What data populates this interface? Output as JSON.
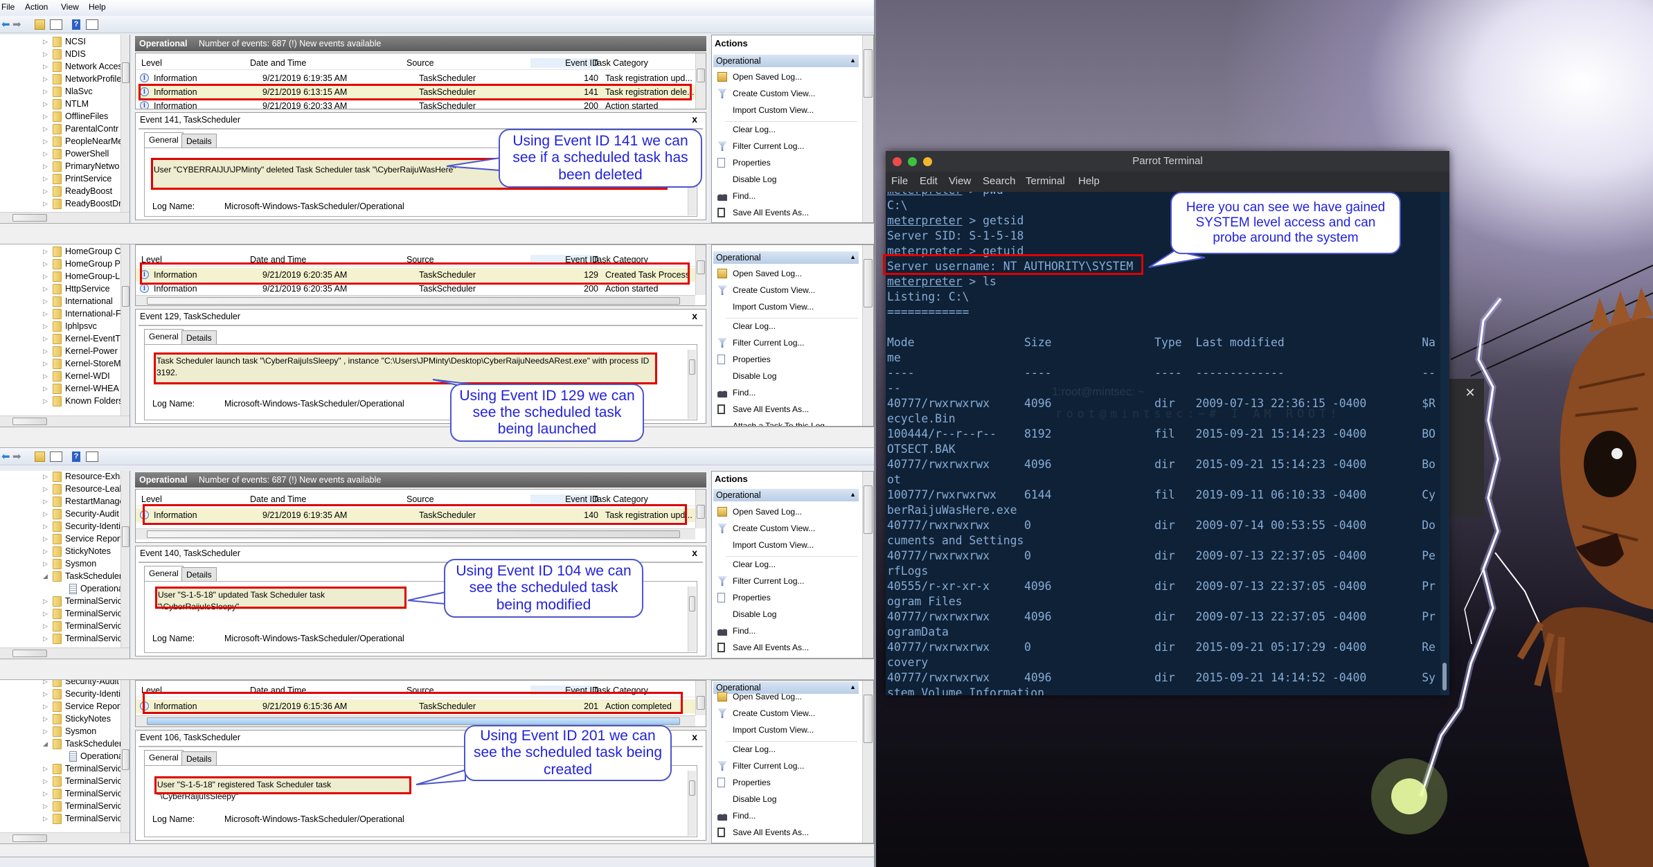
{
  "event_viewer": {
    "menu": [
      "File",
      "Action",
      "View",
      "Help"
    ],
    "columns": [
      "Level",
      "Date and Time",
      "Source",
      "Event ID",
      "Task Category"
    ],
    "tabs": [
      "General",
      "Details"
    ],
    "log_name_label": "Log Name:",
    "log_name": "Microsoft-Windows-TaskScheduler/Operational",
    "actions_header": "Actions",
    "actions_section": "Operational",
    "actions": [
      {
        "label": "Open Saved Log...",
        "icon": "open-folder-icon"
      },
      {
        "label": "Create Custom View...",
        "icon": "filter-icon"
      },
      {
        "label": "Import Custom View...",
        "icon": ""
      },
      {
        "label": "Clear Log...",
        "icon": ""
      },
      {
        "label": "Filter Current Log...",
        "icon": "filter-icon"
      },
      {
        "label": "Properties",
        "icon": "properties-icon"
      },
      {
        "label": "Disable Log",
        "icon": ""
      },
      {
        "label": "Find...",
        "icon": "binoculars-icon"
      },
      {
        "label": "Save All Events As...",
        "icon": "save-icon"
      },
      {
        "label": "Attach a Task To this Log...",
        "icon": ""
      }
    ],
    "panels": [
      {
        "header": {
          "title": "Operational",
          "info": "Number of events: 687 (!) New events available"
        },
        "tree": [
          {
            "label": "NCSI"
          },
          {
            "label": "NDIS"
          },
          {
            "label": "Network Acces"
          },
          {
            "label": "NetworkProfile"
          },
          {
            "label": "NlaSvc"
          },
          {
            "label": "NTLM"
          },
          {
            "label": "OfflineFiles"
          },
          {
            "label": "ParentalContr"
          },
          {
            "label": "PeopleNearMe"
          },
          {
            "label": "PowerShell"
          },
          {
            "label": "PrimaryNetwo"
          },
          {
            "label": "PrintService"
          },
          {
            "label": "ReadyBoost"
          },
          {
            "label": "ReadyBoostDri"
          }
        ],
        "rows": [
          {
            "level": "Information",
            "date": "9/21/2019 6:19:35 AM",
            "source": "TaskScheduler",
            "id": "140",
            "category": "Task registration upd...",
            "highlight": false
          },
          {
            "level": "Information",
            "date": "9/21/2019 6:13:15 AM",
            "source": "TaskScheduler",
            "id": "141",
            "category": "Task registration dele...",
            "highlight": true
          },
          {
            "level": "Information",
            "date": "9/21/2019 6:20:33 AM",
            "source": "TaskScheduler",
            "id": "200",
            "category": "Action started",
            "highlight": false
          }
        ],
        "detail_title": "Event 141, TaskScheduler",
        "message": "User \"CYBERRAIJU\\JPMinty\"  deleted Task Scheduler task \"\\CyberRaijuWasHere\""
      },
      {
        "header": null,
        "tree": [
          {
            "label": "HomeGroup C"
          },
          {
            "label": "HomeGroup P"
          },
          {
            "label": "HomeGroup-L"
          },
          {
            "label": "HttpService"
          },
          {
            "label": "International"
          },
          {
            "label": "International-F"
          },
          {
            "label": "Iphlpsvc"
          },
          {
            "label": "Kernel-EventTr"
          },
          {
            "label": "Kernel-Power"
          },
          {
            "label": "Kernel-StoreM"
          },
          {
            "label": "Kernel-WDI"
          },
          {
            "label": "Kernel-WHEA"
          },
          {
            "label": "Known Folders"
          }
        ],
        "rows": [
          {
            "level": "Information",
            "date": "9/21/2019 6:20:35 AM",
            "source": "TaskScheduler",
            "id": "129",
            "category": "Created Task Process",
            "highlight": true
          },
          {
            "level": "Information",
            "date": "9/21/2019 6:20:35 AM",
            "source": "TaskScheduler",
            "id": "200",
            "category": "Action started",
            "highlight": false
          }
        ],
        "detail_title": "Event 129, TaskScheduler",
        "message": "Task Scheduler launch task \"\\CyberRaijuIsSleepy\" , instance \"C:\\Users\\JPMinty\\Desktop\\CyberRaijuNeedsARest.exe\"  with process ID 3192."
      },
      {
        "header": {
          "title": "Operational",
          "info": "Number of events: 687 (!) New events available"
        },
        "tree": [
          {
            "label": "Resource-Exha"
          },
          {
            "label": "Resource-Leak"
          },
          {
            "label": "RestartManage"
          },
          {
            "label": "Security-Audit"
          },
          {
            "label": "Security-Identi"
          },
          {
            "label": "Service Report"
          },
          {
            "label": "StickyNotes"
          },
          {
            "label": "Sysmon"
          },
          {
            "label": "TaskScheduler",
            "expanded": true
          },
          {
            "label": "Operational",
            "child": true
          },
          {
            "label": "TerminalServic"
          },
          {
            "label": "TerminalServic"
          },
          {
            "label": "TerminalServic"
          },
          {
            "label": "TerminalServic"
          }
        ],
        "rows": [
          {
            "level": "Information",
            "date": "9/21/2019 6:19:35 AM",
            "source": "TaskScheduler",
            "id": "140",
            "category": "Task registration upd...",
            "highlight": true
          }
        ],
        "detail_title": "Event 140, TaskScheduler",
        "message": "User \"S-1-5-18\"  updated Task Scheduler task \"\\CyberRaijuIsSleepy\""
      },
      {
        "header": null,
        "tree": [
          {
            "label": "Security-Audit"
          },
          {
            "label": "Security-Identi"
          },
          {
            "label": "Service Report"
          },
          {
            "label": "StickyNotes"
          },
          {
            "label": "Sysmon"
          },
          {
            "label": "TaskScheduler",
            "expanded": true
          },
          {
            "label": "Operational",
            "child": true
          },
          {
            "label": "TerminalServic"
          },
          {
            "label": "TerminalServic"
          },
          {
            "label": "TerminalServic"
          },
          {
            "label": "TerminalServic"
          },
          {
            "label": "TerminalServic"
          }
        ],
        "rows": [
          {
            "level": "Information",
            "date": "9/21/2019 6:15:36 AM",
            "source": "TaskScheduler",
            "id": "201",
            "category": "Action completed",
            "highlight": true
          }
        ],
        "detail_title": "Event 106, TaskScheduler",
        "message": "User \"S-1-5-18\"  registered Task Scheduler task \"\\CyberRaijuIsSleepy\""
      }
    ]
  },
  "callouts": [
    "Using Event ID 141 we can see if a scheduled task has been deleted",
    "Using Event ID 129 we can see the scheduled task being launched",
    "Using Event ID 104 we can see the scheduled task being modified",
    "Using Event ID 201 we can see the scheduled task being created",
    "Here you can see we have gained SYSTEM level access and can probe around the system"
  ],
  "terminal": {
    "title": "Parrot Terminal",
    "menu": [
      "File",
      "Edit",
      "View",
      "Search",
      "Terminal",
      "Help"
    ],
    "session": [
      {
        "prompt": "meterpreter",
        "command": "pwd"
      },
      {
        "output": "C:\\"
      },
      {
        "prompt": "meterpreter",
        "command": "getsid"
      },
      {
        "output": "Server SID: S-1-5-18"
      },
      {
        "prompt": "meterpreter",
        "command": "getuid"
      },
      {
        "output": "Server username: NT AUTHORITY\\SYSTEM",
        "highlight": true
      },
      {
        "prompt": "meterpreter",
        "command": "ls"
      },
      {
        "output": "Listing: C:\\"
      },
      {
        "output": "============"
      },
      {
        "output": ""
      }
    ],
    "listing": {
      "columns": [
        "Mode",
        "Size",
        "Type",
        "Last modified",
        "Name"
      ],
      "dashes": [
        "----",
        "----",
        "----",
        "-------------",
        "----"
      ],
      "rows": [
        {
          "mode": "40777/rwxrwxrwx",
          "size": "4096",
          "type": "dir",
          "modified": "2009-07-13 22:36:15 -0400",
          "name": "$Recycle.Bin"
        },
        {
          "mode": "100444/r--r--r--",
          "size": "8192",
          "type": "fil",
          "modified": "2015-09-21 15:14:23 -0400",
          "name": "BOOTSECT.BAK"
        },
        {
          "mode": "40777/rwxrwxrwx",
          "size": "4096",
          "type": "dir",
          "modified": "2015-09-21 15:14:23 -0400",
          "name": "Boot"
        },
        {
          "mode": "100777/rwxrwxrwx",
          "size": "6144",
          "type": "fil",
          "modified": "2019-09-11 06:10:33 -0400",
          "name": "CyberRaijuWasHere.exe"
        },
        {
          "mode": "40777/rwxrwxrwx",
          "size": "0",
          "type": "dir",
          "modified": "2009-07-14 00:53:55 -0400",
          "name": "Documents and Settings"
        },
        {
          "mode": "40777/rwxrwxrwx",
          "size": "0",
          "type": "dir",
          "modified": "2009-07-13 22:37:05 -0400",
          "name": "PerfLogs"
        },
        {
          "mode": "40555/r-xr-xr-x",
          "size": "4096",
          "type": "dir",
          "modified": "2009-07-13 22:37:05 -0400",
          "name": "Program Files"
        },
        {
          "mode": "40777/rwxrwxrwx",
          "size": "4096",
          "type": "dir",
          "modified": "2009-07-13 22:37:05 -0400",
          "name": "ProgramData"
        },
        {
          "mode": "40777/rwxrwxrwx",
          "size": "0",
          "type": "dir",
          "modified": "2015-09-21 05:17:29 -0400",
          "name": "Recovery"
        },
        {
          "mode": "40777/rwxrwxrwx",
          "size": "4096",
          "type": "dir",
          "modified": "2015-09-21 14:14:52 -0400",
          "name": "System Volume Information"
        }
      ]
    },
    "background_window": {
      "tab": "1:root@mintsec: ~",
      "line": "root@mintsec:~# I AM ROOT!"
    }
  },
  "colors": {
    "highlight_box": "#e00000",
    "callout_text": "#2222dd",
    "terminal_bg": "#0f2136",
    "terminal_text": "#86acd6"
  }
}
